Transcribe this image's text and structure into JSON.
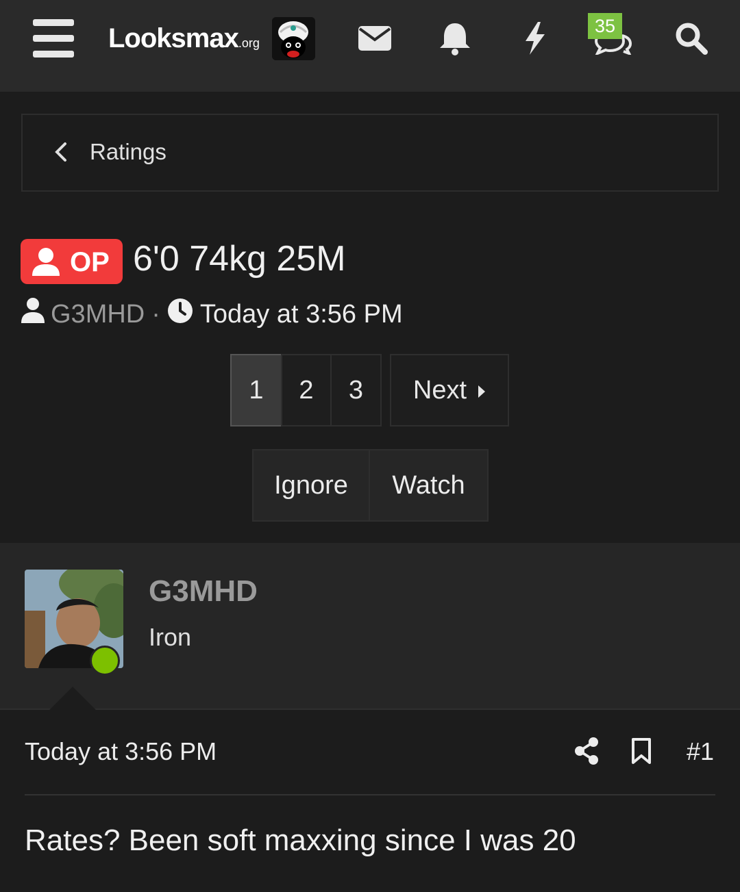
{
  "header": {
    "logo_main": "Looksmax",
    "logo_suffix": ".org",
    "conversations_badge": "35"
  },
  "breadcrumb": {
    "label": "Ratings"
  },
  "thread": {
    "prefix": "OP",
    "title": "6'0 74kg 25M",
    "author": "G3MHD",
    "separator": "·",
    "time": "Today at 3:56 PM"
  },
  "pagination": {
    "pages": [
      "1",
      "2",
      "3"
    ],
    "current": "1",
    "next_label": "Next"
  },
  "actions": {
    "ignore_label": "Ignore",
    "watch_label": "Watch"
  },
  "post": {
    "username": "G3MHD",
    "user_title": "Iron",
    "time": "Today at 3:56 PM",
    "number": "#1",
    "body": "Rates? Been soft maxxing since I was 20",
    "online_color": "#7dc000"
  },
  "icons": [
    "menu-icon",
    "envelope-icon",
    "bell-icon",
    "bolt-icon",
    "conversations-icon",
    "search-icon",
    "chevron-left-icon",
    "user-icon",
    "clock-icon",
    "caret-right-icon",
    "share-icon",
    "bookmark-icon"
  ],
  "colors": {
    "accent_red": "#f23b3b",
    "badge_green": "#7dc242",
    "background": "#1c1c1c",
    "header": "#2a2a2a"
  }
}
